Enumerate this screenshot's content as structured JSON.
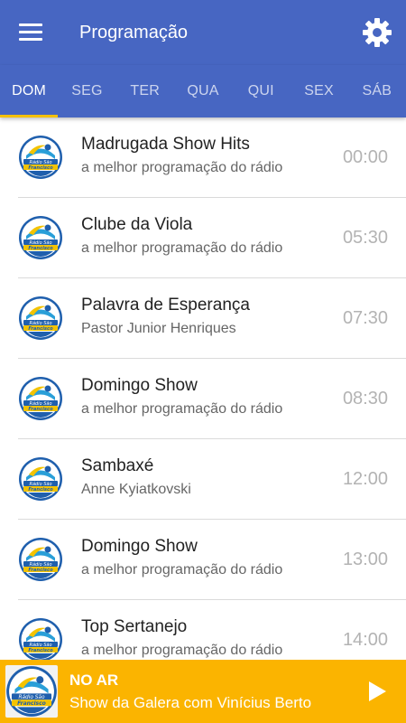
{
  "appbar": {
    "title": "Programação",
    "menu_icon": "hamburger-menu-icon",
    "settings_icon": "gear-icon",
    "color": "#4766c2"
  },
  "tabs": [
    {
      "label": "DOM",
      "active": true
    },
    {
      "label": "SEG",
      "active": false
    },
    {
      "label": "TER",
      "active": false
    },
    {
      "label": "QUA",
      "active": false
    },
    {
      "label": "QUI",
      "active": false
    },
    {
      "label": "SEX",
      "active": false
    },
    {
      "label": "SÁB",
      "active": false
    }
  ],
  "tab_indicator_color": "#f5c000",
  "logo": {
    "text": "Rádio São Francisco",
    "icon": "radio-logo-icon"
  },
  "schedule": [
    {
      "name": "Madrugada Show Hits",
      "host": "a melhor programação do rádio",
      "time": "00:00"
    },
    {
      "name": "Clube da Viola",
      "host": "a melhor programação do rádio",
      "time": "05:30"
    },
    {
      "name": "Palavra de Esperança",
      "host": "Pastor Junior Henriques",
      "time": "07:30"
    },
    {
      "name": "Domingo Show",
      "host": "a melhor programação do rádio",
      "time": "08:30"
    },
    {
      "name": "Sambaxé",
      "host": "Anne Kyiatkovski",
      "time": "12:00"
    },
    {
      "name": "Domingo Show",
      "host": "a melhor programação do rádio",
      "time": "13:00"
    },
    {
      "name": "Top Sertanejo",
      "host": "a melhor programação do rádio",
      "time": "14:00"
    }
  ],
  "player": {
    "status": "NO AR",
    "show": "Show da Galera com Vinícius Berto",
    "play_icon": "play-icon",
    "color": "#fbb400"
  }
}
